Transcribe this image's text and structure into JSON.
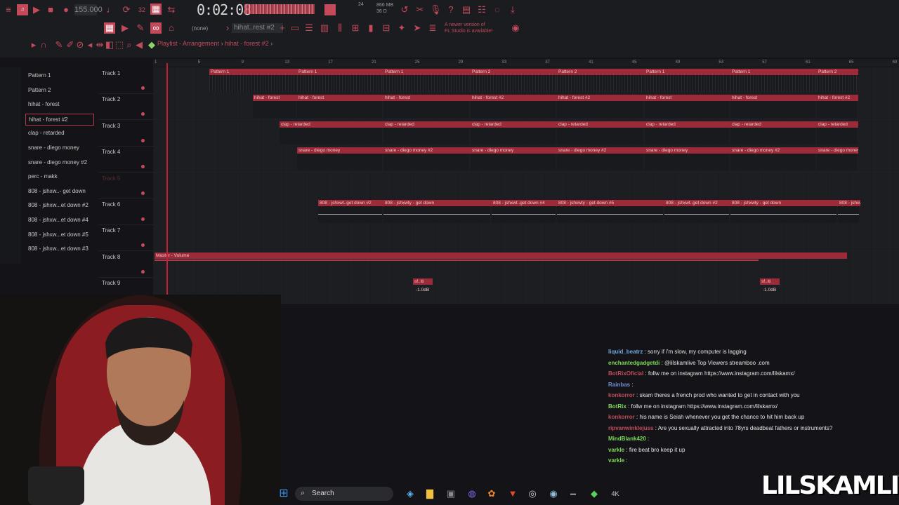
{
  "toolbar": {
    "tempo": "155.000",
    "time_display": "0:02:08",
    "memory": "866 MB",
    "memory_sub": "36 D",
    "cpu": "24",
    "update_hint_line1": "A newer version of",
    "update_hint_line2": "FL Studio is available!",
    "pattern_selector": "hihat..rest #2",
    "snap": "(none)"
  },
  "breadcrumb": {
    "window": "Playlist - Arrangement",
    "pattern": "hihat - forest #2"
  },
  "channels": [
    "Pattern 1",
    "Pattern 2",
    "hihat - forest",
    "hihat - forest #2",
    "clap - retarded",
    "snare - diego money",
    "snare - diego money #2",
    "perc - makk",
    "808 - jshxw..- get down",
    "808 - jshxw...et down #2",
    "808 - jshxw...et down #4",
    "808 - jshxw...et down #5",
    "808 - jshxw...et down #3"
  ],
  "ruler_marks": [
    "1",
    "5",
    "9",
    "13",
    "17",
    "21",
    "25",
    "29",
    "33",
    "37",
    "41",
    "45",
    "49",
    "53",
    "57",
    "61",
    "65",
    "69"
  ],
  "tracks": [
    {
      "name": "Track 1"
    },
    {
      "name": "Track 2"
    },
    {
      "name": "Track 3"
    },
    {
      "name": "Track 4"
    },
    {
      "name": "Track 5"
    },
    {
      "name": "Track 6"
    },
    {
      "name": "Track 7"
    },
    {
      "name": "Track 8"
    },
    {
      "name": "Track 9"
    }
  ],
  "clips": {
    "t1": [
      "Pattern 1",
      "Pattern 1",
      "Pattern 1",
      "Pattern 2",
      "Pattern 2",
      "Pattern 1",
      "Pattern 1",
      "Pattern 2"
    ],
    "t2": [
      "hihat - forest",
      "hihat - forest",
      "hihat - forest",
      "hihat - forest #2",
      "hihat - forest #2",
      "hihat - forest",
      "hihat - forest",
      "hihat - forest #2"
    ],
    "t3": [
      "clap - retarded",
      "clap - retarded",
      "clap - retarded",
      "clap - retarded",
      "clap - retarded",
      "clap - retarded",
      "clap - retarded"
    ],
    "t4": [
      "snare - diego money",
      "snare - diego money #2",
      "snare - diego money",
      "snare - diego money #2",
      "snare - diego money",
      "snare - diego money #2",
      "snare - diego money"
    ],
    "t6": [
      "808 - jshxwt..get down #2",
      "808 - jshxwty - get down",
      "808 - jshxwt..get down #4",
      "808 - jshxwty - get down #5",
      "808 - jshxwt..get down #2",
      "808 - jshxwty - get down",
      "808 - jshxwt..get down #4"
    ],
    "t8": "Master - Volume",
    "t9": [
      "sf..iti",
      "-1.0dB",
      "sf..iti",
      "-1.0dB"
    ]
  },
  "chat": [
    {
      "user": "liquid_beatrz",
      "text": "sorry if i'm slow, my computer is lagging",
      "color": "#6fa8dc"
    },
    {
      "user": "enchantedgadgetdi",
      "text": "@lilskamlive Top Viewers streamboo .com",
      "color": "#7ed957"
    },
    {
      "user": "BotRixOficial",
      "text": "follw me on instagram https://www.instagram.com/lilskamx/",
      "color": "#c24a5a"
    },
    {
      "user": "Rainbas",
      "text": "",
      "color": "#6f8fd9"
    },
    {
      "user": "konkorror",
      "text": "skam theres a french prod who wanted to get in contact with you",
      "color": "#c24a5a"
    },
    {
      "user": "BotRix",
      "text": "follw me on instagram https://www.instagram.com/lilskamx/",
      "color": "#7ed957"
    },
    {
      "user": "konkorror",
      "text": "his name is Seiah whenever you get the chance to hit him back up",
      "color": "#c24a5a"
    },
    {
      "user": "ripvanwinklejuss",
      "text": "Are you sexually attracted into 78yrs deadbeat fathers or instruments?",
      "color": "#c24a5a"
    },
    {
      "user": "MindBlank420",
      "text": "",
      "color": "#7ed957"
    },
    {
      "user": "varkle",
      "text": "fire beat bro keep it up",
      "color": "#7ed957"
    },
    {
      "user": "varkle",
      "text": "",
      "color": "#7ed957"
    }
  ],
  "taskbar": {
    "search_label": "Search"
  },
  "watermark": "LILSKAMLIVE",
  "colors": {
    "accent": "#c24a5a",
    "clip": "#9c2a38",
    "background": "#141418"
  }
}
